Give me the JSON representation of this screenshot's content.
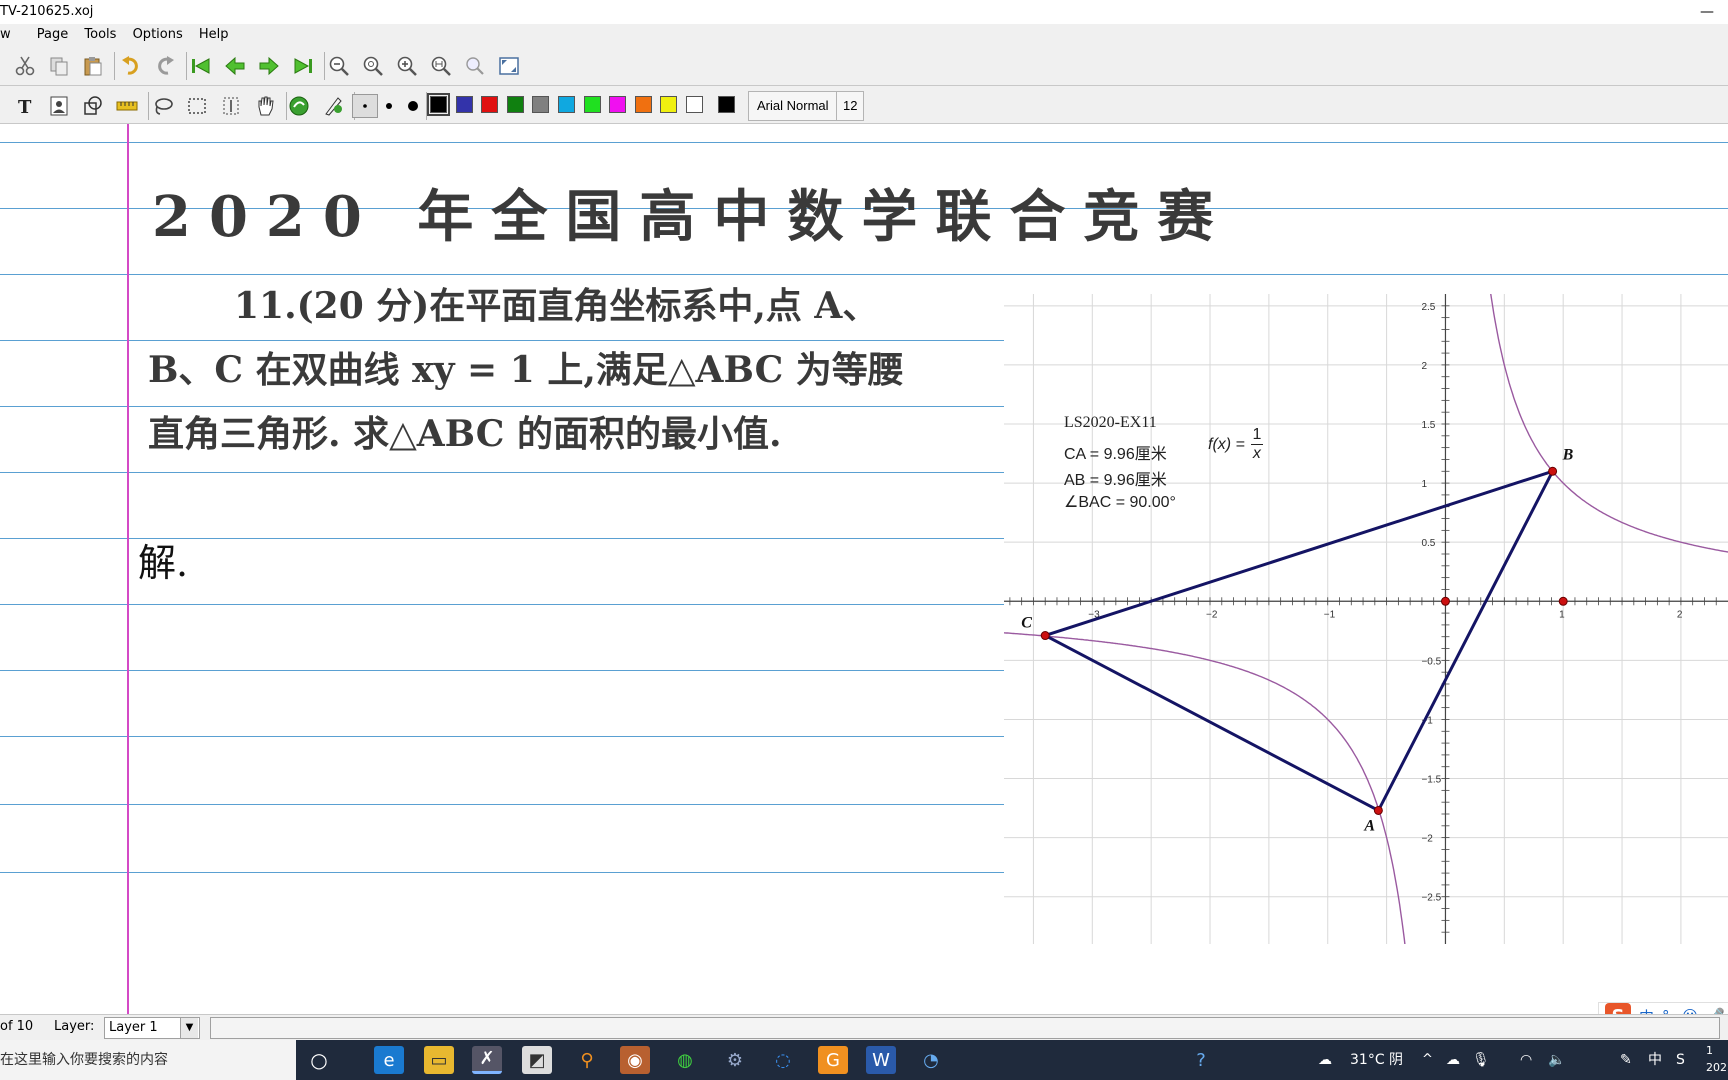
{
  "window": {
    "title": "TV-210625.xoj",
    "minimize": "—"
  },
  "menu": [
    {
      "label": "w"
    },
    {
      "label": "Page"
    },
    {
      "label": "Tools"
    },
    {
      "label": "Options"
    },
    {
      "label": "Help"
    }
  ],
  "toolbar": {
    "font_name": "Arial Normal",
    "font_size": "12",
    "colors": [
      "#000000",
      "#3333aa",
      "#e01010",
      "#108010",
      "#808080",
      "#10a8e0",
      "#20e020",
      "#f010f0",
      "#f07010",
      "#f0f010",
      "#ffffff"
    ],
    "current_color": "#000000"
  },
  "document": {
    "heading": "2020 年全国高中数学联合竞赛",
    "problem_number": "11.",
    "problem_line1": "(20 分)在平面直角坐标系中,点 A、",
    "problem_line2": "B、C 在双曲线 xy = 1 上,满足△ABC 为等腰",
    "problem_line3": "直角三角形. 求△ABC 的面积的最小值.",
    "answer_start": "解."
  },
  "geometry": {
    "label": "LS2020-EX11",
    "ca": "CA = 9.96厘米",
    "ab": "AB = 9.96厘米",
    "angle": "∠BAC = 90.00°",
    "function": "f(x) = 1/x",
    "function_lhs": "f(x) =",
    "function_num": "1",
    "function_den": "x",
    "point_labels": {
      "A": "A",
      "B": "B",
      "C": "C"
    },
    "x_ticks": [
      "−3",
      "−2",
      "−1",
      "1",
      "2"
    ],
    "y_ticks": [
      "2.5",
      "2",
      "1.5",
      "1",
      "0.5",
      "−0.5",
      "−1",
      "−1.5",
      "−2",
      "−2.5"
    ],
    "triangle_color": "#141464",
    "curve_color": "#9a5aa0",
    "point_color": "#cc1010",
    "points": {
      "A": [
        -0.57,
        -1.77
      ],
      "B": [
        0.91,
        1.1
      ],
      "C": [
        -3.4,
        -0.29
      ]
    },
    "extra_points": [
      [
        0,
        0
      ],
      [
        1,
        0
      ]
    ],
    "x_range": [
      -3.75,
      2.4
    ],
    "y_range": [
      -2.9,
      2.6
    ]
  },
  "ime": {
    "logo": "S",
    "mode": "中",
    "punct": "°,",
    "emoji": "☺",
    "mic": "🎤"
  },
  "status": {
    "page": "of 10",
    "layer_label": "Layer:",
    "layer_value": "Layer 1"
  },
  "taskbar": {
    "search_placeholder": "在这里输入你要搜索的内容",
    "weather": "31°C 阴",
    "ime": "中",
    "clock_top": "1",
    "clock_bottom": "202"
  }
}
